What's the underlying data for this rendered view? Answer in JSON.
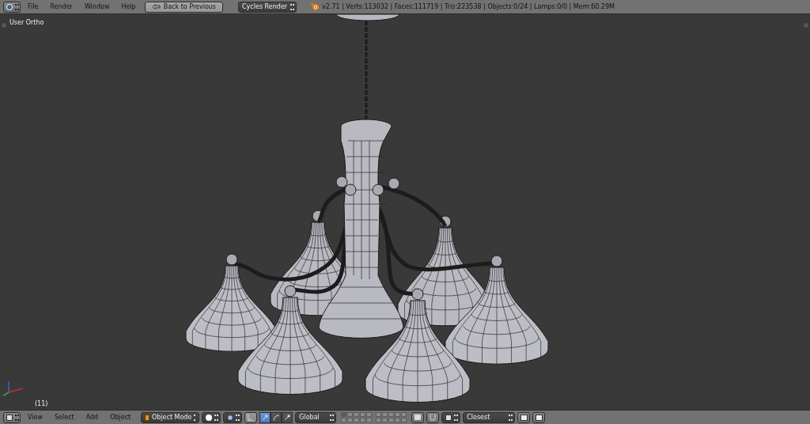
{
  "top_bar": {
    "menus": [
      "File",
      "Render",
      "Window",
      "Help"
    ],
    "back_button": "Back to Previous",
    "render_engine": "Cycles Render",
    "stats": "v2.71 | Verts:113032 | Faces:111719 | Tris:223538 | Objects:0/24 | Lamps:0/0 | Mem:60.29M"
  },
  "viewport": {
    "view_label": "User Ortho",
    "frame_label": "(11)"
  },
  "bottom_bar": {
    "menus": [
      "View",
      "Select",
      "Add",
      "Object"
    ],
    "mode": "Object Mode",
    "manipulator_enabled": true,
    "transform_tools": [
      {
        "kind": "translate",
        "selected": true
      },
      {
        "kind": "rotate",
        "selected": false
      },
      {
        "kind": "scale",
        "selected": false
      }
    ],
    "orientation": "Global",
    "layers": [
      {
        "selected": true
      },
      {
        "selected": false
      },
      {
        "selected": false
      },
      {
        "selected": false
      },
      {
        "selected": false
      },
      {
        "selected": false
      },
      {
        "selected": false
      },
      {
        "selected": false
      },
      {
        "selected": false
      },
      {
        "selected": false
      },
      {
        "selected": false
      },
      {
        "selected": false
      },
      {
        "selected": false
      },
      {
        "selected": false
      },
      {
        "selected": false
      },
      {
        "selected": false
      },
      {
        "selected": false
      },
      {
        "selected": false
      },
      {
        "selected": false
      },
      {
        "selected": false
      }
    ],
    "snap_target": "Closest"
  }
}
